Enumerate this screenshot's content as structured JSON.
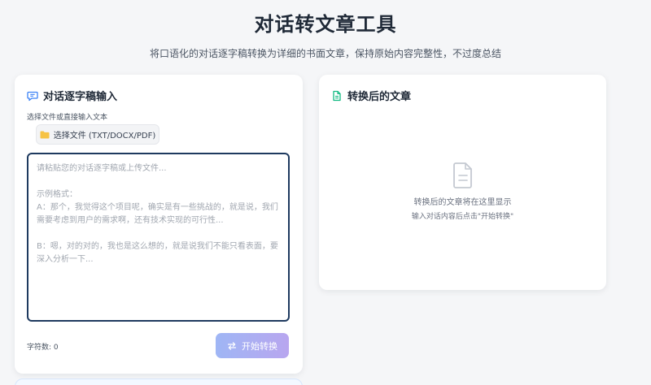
{
  "header": {
    "title": "对话转文章工具",
    "subtitle": "将口语化的对话逐字稿转换为详细的书面文章，保持原始内容完整性，不过度总结"
  },
  "input_panel": {
    "title": "对话逐字稿输入",
    "icon": "message-square-icon",
    "file_hint": "选择文件或直接输入文本",
    "file_button": {
      "label": "选择文件 (TXT/DOCX/PDF)",
      "icon": "folder-icon"
    },
    "textarea": {
      "value": "",
      "placeholder": "请粘贴您的对话逐字稿或上传文件...\n\n示例格式：\nA：那个，我觉得这个项目呢，确实是有一些挑战的，就是说，我们需要考虑到用户的需求啊，还有技术实现的可行性...\n\nB：嗯，对的对的，我也是这么想的，就是说我们不能只看表面，要深入分析一下..."
    },
    "char_count_label": "字符数:",
    "char_count": "0",
    "convert_button": {
      "label": "开始转换",
      "icon": "swap-arrows-icon"
    }
  },
  "output_panel": {
    "title": "转换后的文章",
    "icon": "file-text-icon",
    "empty_icon": "document-icon",
    "empty_line1": "转换后的文章将在这里显示",
    "empty_line2": "输入对话内容后点击\"开始转换\""
  },
  "colors": {
    "accent": "#3b82f6",
    "success": "#10b981",
    "button_gradient_start": "#9fb6f5",
    "button_gradient_end": "#b8a6ef",
    "textarea_border": "#1e3a5f"
  }
}
